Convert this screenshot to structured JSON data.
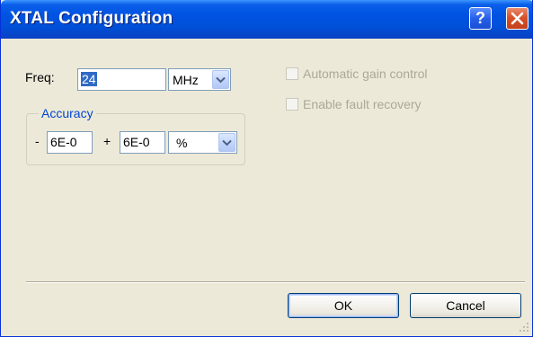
{
  "window": {
    "title": "XTAL Configuration"
  },
  "titlebar_buttons": {
    "help": "?"
  },
  "freq": {
    "label": "Freq:",
    "value": "24",
    "unit": "MHz"
  },
  "accuracy": {
    "group_label": "Accuracy",
    "minus_sign": "-",
    "minus_value": "6E-0",
    "plus_sign": "+",
    "plus_value": "6E-0",
    "unit": "%"
  },
  "options": {
    "agc_label": "Automatic gain control",
    "fault_label": "Enable fault recovery"
  },
  "buttons": {
    "ok": "OK",
    "cancel": "Cancel"
  },
  "colors": {
    "title_bar": "#0054e3",
    "dialog_bg": "#ece9d8",
    "selection": "#316ac5",
    "group_label": "#0046d5",
    "disabled_text": "#aca899"
  }
}
